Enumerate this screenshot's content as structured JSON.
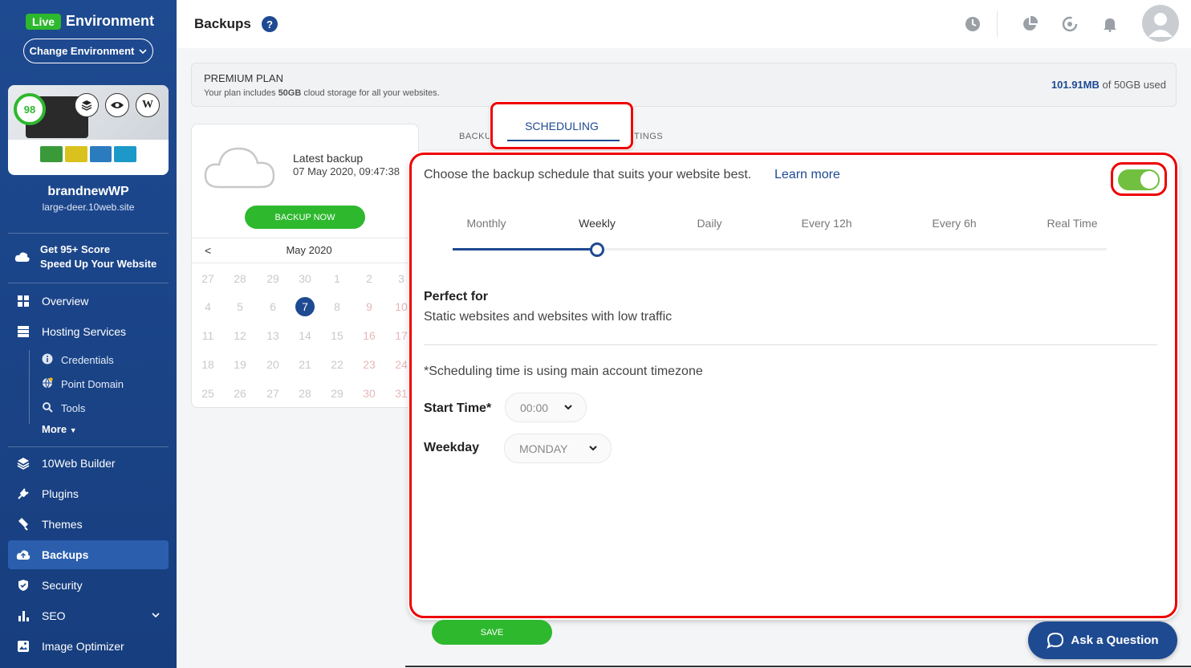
{
  "env": {
    "badge": "Live",
    "label": "Environment",
    "change_button": "Change Environment"
  },
  "site": {
    "score": "98",
    "name": "brandnewWP",
    "url": "large-deer.10web.site"
  },
  "promo": {
    "line1": "Get 95+ Score",
    "line2": "Speed Up Your Website"
  },
  "nav": {
    "overview": "Overview",
    "hosting": "Hosting Services",
    "credentials": "Credentials",
    "point_domain": "Point Domain",
    "tools": "Tools",
    "more": "More",
    "builder": "10Web Builder",
    "plugins": "Plugins",
    "themes": "Themes",
    "backups": "Backups",
    "security": "Security",
    "seo": "SEO",
    "image_optimizer": "Image Optimizer"
  },
  "header": {
    "title": "Backups",
    "help": "?"
  },
  "plan": {
    "title": "PREMIUM PLAN",
    "desc_pre": "Your plan includes ",
    "desc_bold": "50GB",
    "desc_post": " cloud storage for all your websites.",
    "used_value": "101.91MB",
    "used_rest": " of 50GB used"
  },
  "backup": {
    "latest_label": "Latest backup",
    "latest_date": "07 May 2020, 09:47:38",
    "backup_now": "BACKUP NOW",
    "month": "May 2020",
    "prev": "<"
  },
  "calendar_rows": [
    [
      "27",
      "28",
      "29",
      "30",
      "1",
      "2",
      "3"
    ],
    [
      "4",
      "5",
      "6",
      "7",
      "8",
      "9",
      "10"
    ],
    [
      "11",
      "12",
      "13",
      "14",
      "15",
      "16",
      "17"
    ],
    [
      "18",
      "19",
      "20",
      "21",
      "22",
      "23",
      "24"
    ],
    [
      "25",
      "26",
      "27",
      "28",
      "29",
      "30",
      "31"
    ]
  ],
  "tabs": {
    "backups": "BACKU",
    "scheduling": "SCHEDULING",
    "settings": "TINGS"
  },
  "schedule": {
    "intro": "Choose the backup schedule that suits your website best.",
    "learn_more": "Learn more",
    "enabled": true,
    "frequencies": [
      "Monthly",
      "Weekly",
      "Daily",
      "Every 12h",
      "Every 6h",
      "Real Time"
    ],
    "selected_frequency": "Weekly",
    "perfect_title": "Perfect for",
    "perfect_desc": "Static websites and websites with low traffic",
    "timezone_note": "*Scheduling time is using main account timezone",
    "start_time_label": "Start Time*",
    "start_time_value": "00:00",
    "weekday_label": "Weekday",
    "weekday_value": "MONDAY"
  },
  "save": "SAVE",
  "ask": "Ask a Question",
  "colors": {
    "brand_blue": "#1e4a91",
    "green": "#2eb82e",
    "highlight_red": "#ee0000",
    "toggle_green": "#72c040"
  }
}
